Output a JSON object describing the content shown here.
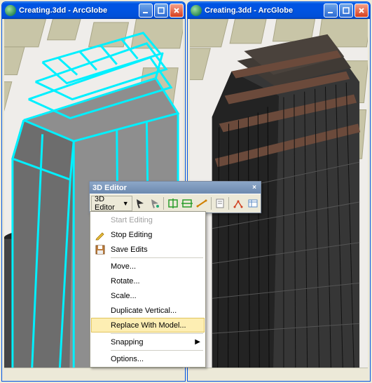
{
  "windows": {
    "left": {
      "title": "Creating.3dd - ArcGlobe"
    },
    "right": {
      "title": "Creating.3dd - ArcGlobe"
    }
  },
  "editor": {
    "title": "3D Editor",
    "dropdown_label": "3D Editor"
  },
  "menu": {
    "start_editing": "Start Editing",
    "stop_editing": "Stop Editing",
    "save_edits": "Save Edits",
    "move": "Move...",
    "rotate": "Rotate...",
    "scale": "Scale...",
    "duplicate_vertical": "Duplicate Vertical...",
    "replace_with_model": "Replace With Model...",
    "snapping": "Snapping",
    "options": "Options..."
  }
}
